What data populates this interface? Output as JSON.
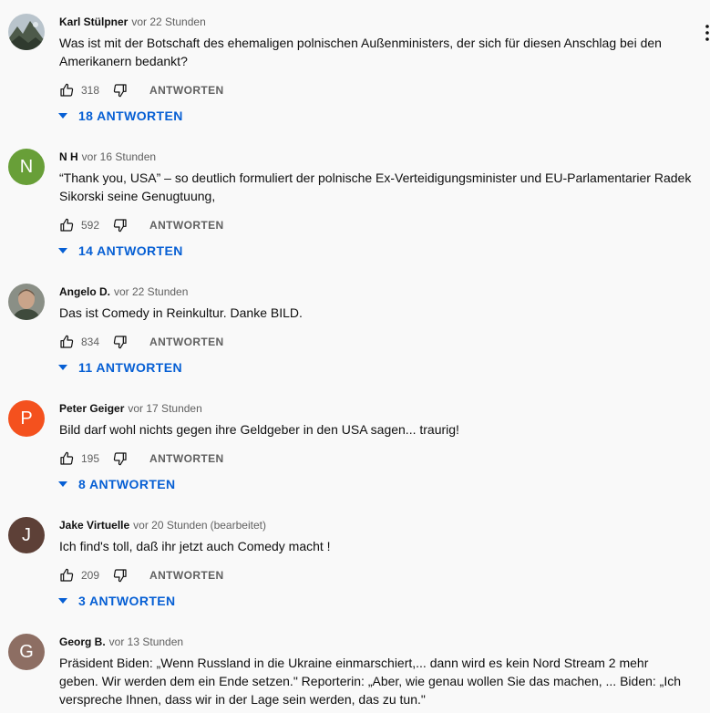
{
  "comments": [
    {
      "author": "Karl Stülpner",
      "time": "vor 22 Stunden",
      "edited": "",
      "text": "Was ist mit der Botschaft des ehemaligen polnischen Außenministers, der sich für diesen Anschlag bei den Amerikanern bedankt?",
      "likes": "318",
      "reply_label": "ANTWORTEN",
      "replies_label": "18 ANTWORTEN",
      "avatar": {
        "kind": "photo",
        "icon": "landscape-photo-avatar"
      }
    },
    {
      "author": "N H",
      "time": "vor 16 Stunden",
      "edited": "",
      "text": "“Thank you, USA” – so deutlich formuliert der polnische Ex-Verteidigungsminister und EU-Parlamentarier Radek Sikorski seine Genugtuung,",
      "likes": "592",
      "reply_label": "ANTWORTEN",
      "replies_label": "14 ANTWORTEN",
      "avatar": {
        "kind": "letter",
        "letter": "N",
        "color": "#689f38"
      }
    },
    {
      "author": "Angelo D.",
      "time": "vor 22 Stunden",
      "edited": "",
      "text": "Das ist Comedy in Reinkultur. Danke BILD.",
      "likes": "834",
      "reply_label": "ANTWORTEN",
      "replies_label": "11 ANTWORTEN",
      "avatar": {
        "kind": "photo",
        "icon": "person-photo-avatar"
      }
    },
    {
      "author": "Peter Geiger",
      "time": "vor 17 Stunden",
      "edited": "",
      "text": "Bild darf wohl nichts gegen ihre Geldgeber in den USA sagen... traurig!",
      "likes": "195",
      "reply_label": "ANTWORTEN",
      "replies_label": "8 ANTWORTEN",
      "avatar": {
        "kind": "letter",
        "letter": "P",
        "color": "#f4511e"
      }
    },
    {
      "author": "Jake Virtuelle",
      "time": "vor 20 Stunden",
      "edited": "(bearbeitet)",
      "text": "Ich find's toll, daß ihr jetzt auch Comedy macht !",
      "likes": "209",
      "reply_label": "ANTWORTEN",
      "replies_label": "3 ANTWORTEN",
      "avatar": {
        "kind": "letter",
        "letter": "J",
        "color": "#5d4037"
      }
    },
    {
      "author": "Georg B.",
      "time": "vor 13 Stunden",
      "edited": "",
      "text": "Präsident Biden: „Wenn Russland in die Ukraine einmarschiert,... dann wird es kein Nord Stream 2 mehr geben. Wir werden dem ein Ende setzen.\" Reporterin: „Aber, wie genau wollen Sie das machen, ...  Biden: „Ich verspreche Ihnen, dass wir in der Lage sein werden, das zu tun.\"",
      "likes": "",
      "reply_label": "",
      "replies_label": "",
      "avatar": {
        "kind": "letter",
        "letter": "G",
        "color": "#8d6e63"
      }
    }
  ],
  "colors": {
    "link_blue": "#065fd4",
    "secondary_text": "#606060",
    "background": "#f9f9f9"
  }
}
